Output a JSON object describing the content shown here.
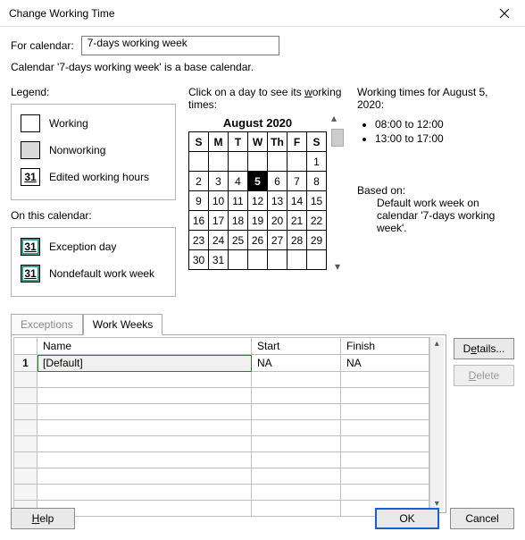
{
  "window": {
    "title": "Change Working Time"
  },
  "forCalendar": {
    "label": "For calendar:",
    "value": "7-days working week",
    "note": "Calendar '7-days working week' is a base calendar."
  },
  "legend": {
    "heading": "Legend:",
    "working": "Working",
    "nonworking": "Nonworking",
    "edited_num": "31",
    "edited": "Edited working hours",
    "onthis": "On this calendar:",
    "exception_num": "31",
    "exception": "Exception day",
    "nondefault_num": "31",
    "nondefault": "Nondefault work week"
  },
  "calendar": {
    "instruction_pre": "Click on a day to see its ",
    "instruction_ul": "w",
    "instruction_post": "orking times:",
    "monthYear": "August 2020",
    "dow": [
      "S",
      "M",
      "T",
      "W",
      "Th",
      "F",
      "S"
    ],
    "weeks": [
      [
        "",
        "",
        "",
        "",
        "",
        "",
        "1"
      ],
      [
        "2",
        "3",
        "4",
        "5",
        "6",
        "7",
        "8"
      ],
      [
        "9",
        "10",
        "11",
        "12",
        "13",
        "14",
        "15"
      ],
      [
        "16",
        "17",
        "18",
        "19",
        "20",
        "21",
        "22"
      ],
      [
        "23",
        "24",
        "25",
        "26",
        "27",
        "28",
        "29"
      ],
      [
        "30",
        "31",
        "",
        "",
        "",
        "",
        ""
      ]
    ],
    "selected": "5"
  },
  "workingTimes": {
    "heading": "Working times for August 5, 2020:",
    "slots": [
      "08:00 to 12:00",
      "13:00 to 17:00"
    ],
    "basedLabel": "Based on:",
    "basedText": "Default work week on calendar '7-days working week'."
  },
  "tabs": {
    "exceptions": "Exceptions",
    "workweeks": "Work Weeks"
  },
  "grid": {
    "headers": {
      "name": "Name",
      "start": "Start",
      "finish": "Finish"
    },
    "rows": [
      {
        "num": "1",
        "name": "[Default]",
        "start": "NA",
        "finish": "NA"
      }
    ]
  },
  "buttons": {
    "details_pre": "D",
    "details_ul": "e",
    "details_post": "tails...",
    "delete_pre": "",
    "delete_ul": "D",
    "delete_post": "elete",
    "help_pre": "",
    "help_ul": "H",
    "help_post": "elp",
    "ok": "OK",
    "cancel": "Cancel"
  }
}
